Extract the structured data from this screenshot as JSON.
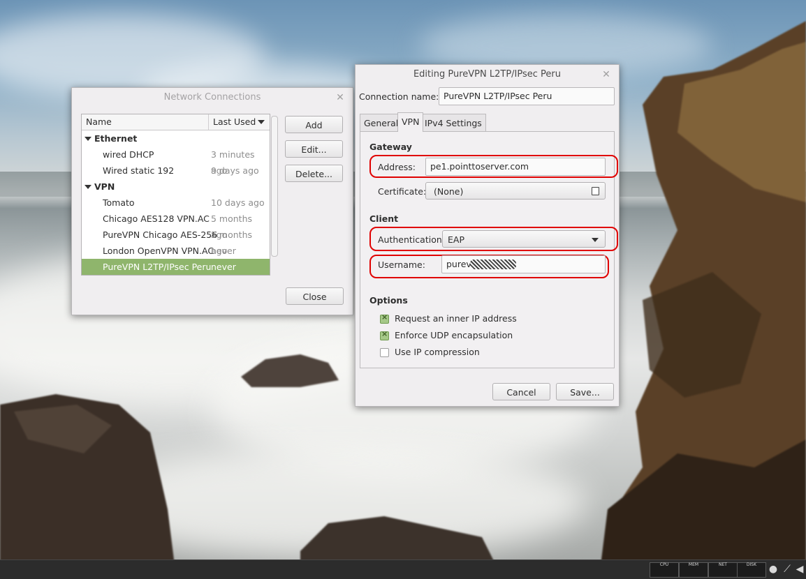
{
  "network_window": {
    "title": "Network Connections",
    "columns": {
      "name": "Name",
      "last_used": "Last Used"
    },
    "groups": [
      {
        "label": "Ethernet",
        "items": [
          {
            "name": "wired DHCP",
            "last_used": "3 minutes ago"
          },
          {
            "name": "Wired static 192",
            "last_used": "9 days ago"
          }
        ]
      },
      {
        "label": "VPN",
        "items": [
          {
            "name": "Tomato",
            "last_used": "10 days ago"
          },
          {
            "name": "Chicago AES128 VPN.AC",
            "last_used": "5 months ago"
          },
          {
            "name": "PureVPN Chicago AES-256",
            "last_used": "5 months ago"
          },
          {
            "name": "London OpenVPN VPN.AC",
            "last_used": "never"
          },
          {
            "name": "PureVPN L2TP/IPsec Peru",
            "last_used": "never",
            "selected": true
          }
        ]
      }
    ],
    "buttons": {
      "add": "Add",
      "edit": "Edit...",
      "delete": "Delete...",
      "close": "Close"
    }
  },
  "edit_window": {
    "title": "Editing PureVPN L2TP/IPsec Peru",
    "connection_name_label": "Connection name:",
    "connection_name_value": "PureVPN L2TP/IPsec Peru",
    "tabs": [
      "General",
      "VPN",
      "IPv4 Settings"
    ],
    "active_tab": "VPN",
    "gateway": {
      "heading": "Gateway",
      "address_label": "Address:",
      "address_value": "pe1.pointtoserver.com",
      "certificate_label": "Certificate:",
      "certificate_value": "(None)"
    },
    "client": {
      "heading": "Client",
      "authentication_label": "Authentication:",
      "authentication_value": "EAP",
      "username_label": "Username:",
      "username_value": "purev"
    },
    "options": {
      "heading": "Options",
      "items": [
        {
          "label": "Request an inner IP address",
          "checked": true
        },
        {
          "label": "Enforce UDP encapsulation",
          "checked": true
        },
        {
          "label": "Use IP compression",
          "checked": false
        }
      ]
    },
    "buttons": {
      "cancel": "Cancel",
      "save": "Save..."
    }
  },
  "taskbar": {
    "monitors": [
      "CPU",
      "MEM",
      "NET",
      "DISK"
    ],
    "tray_icons": [
      "user-icon",
      "network-icon",
      "volume-icon"
    ]
  },
  "colors": {
    "selection": "#8fb56c",
    "highlight": "#e00000",
    "taskbar": "#2c2c2c"
  }
}
